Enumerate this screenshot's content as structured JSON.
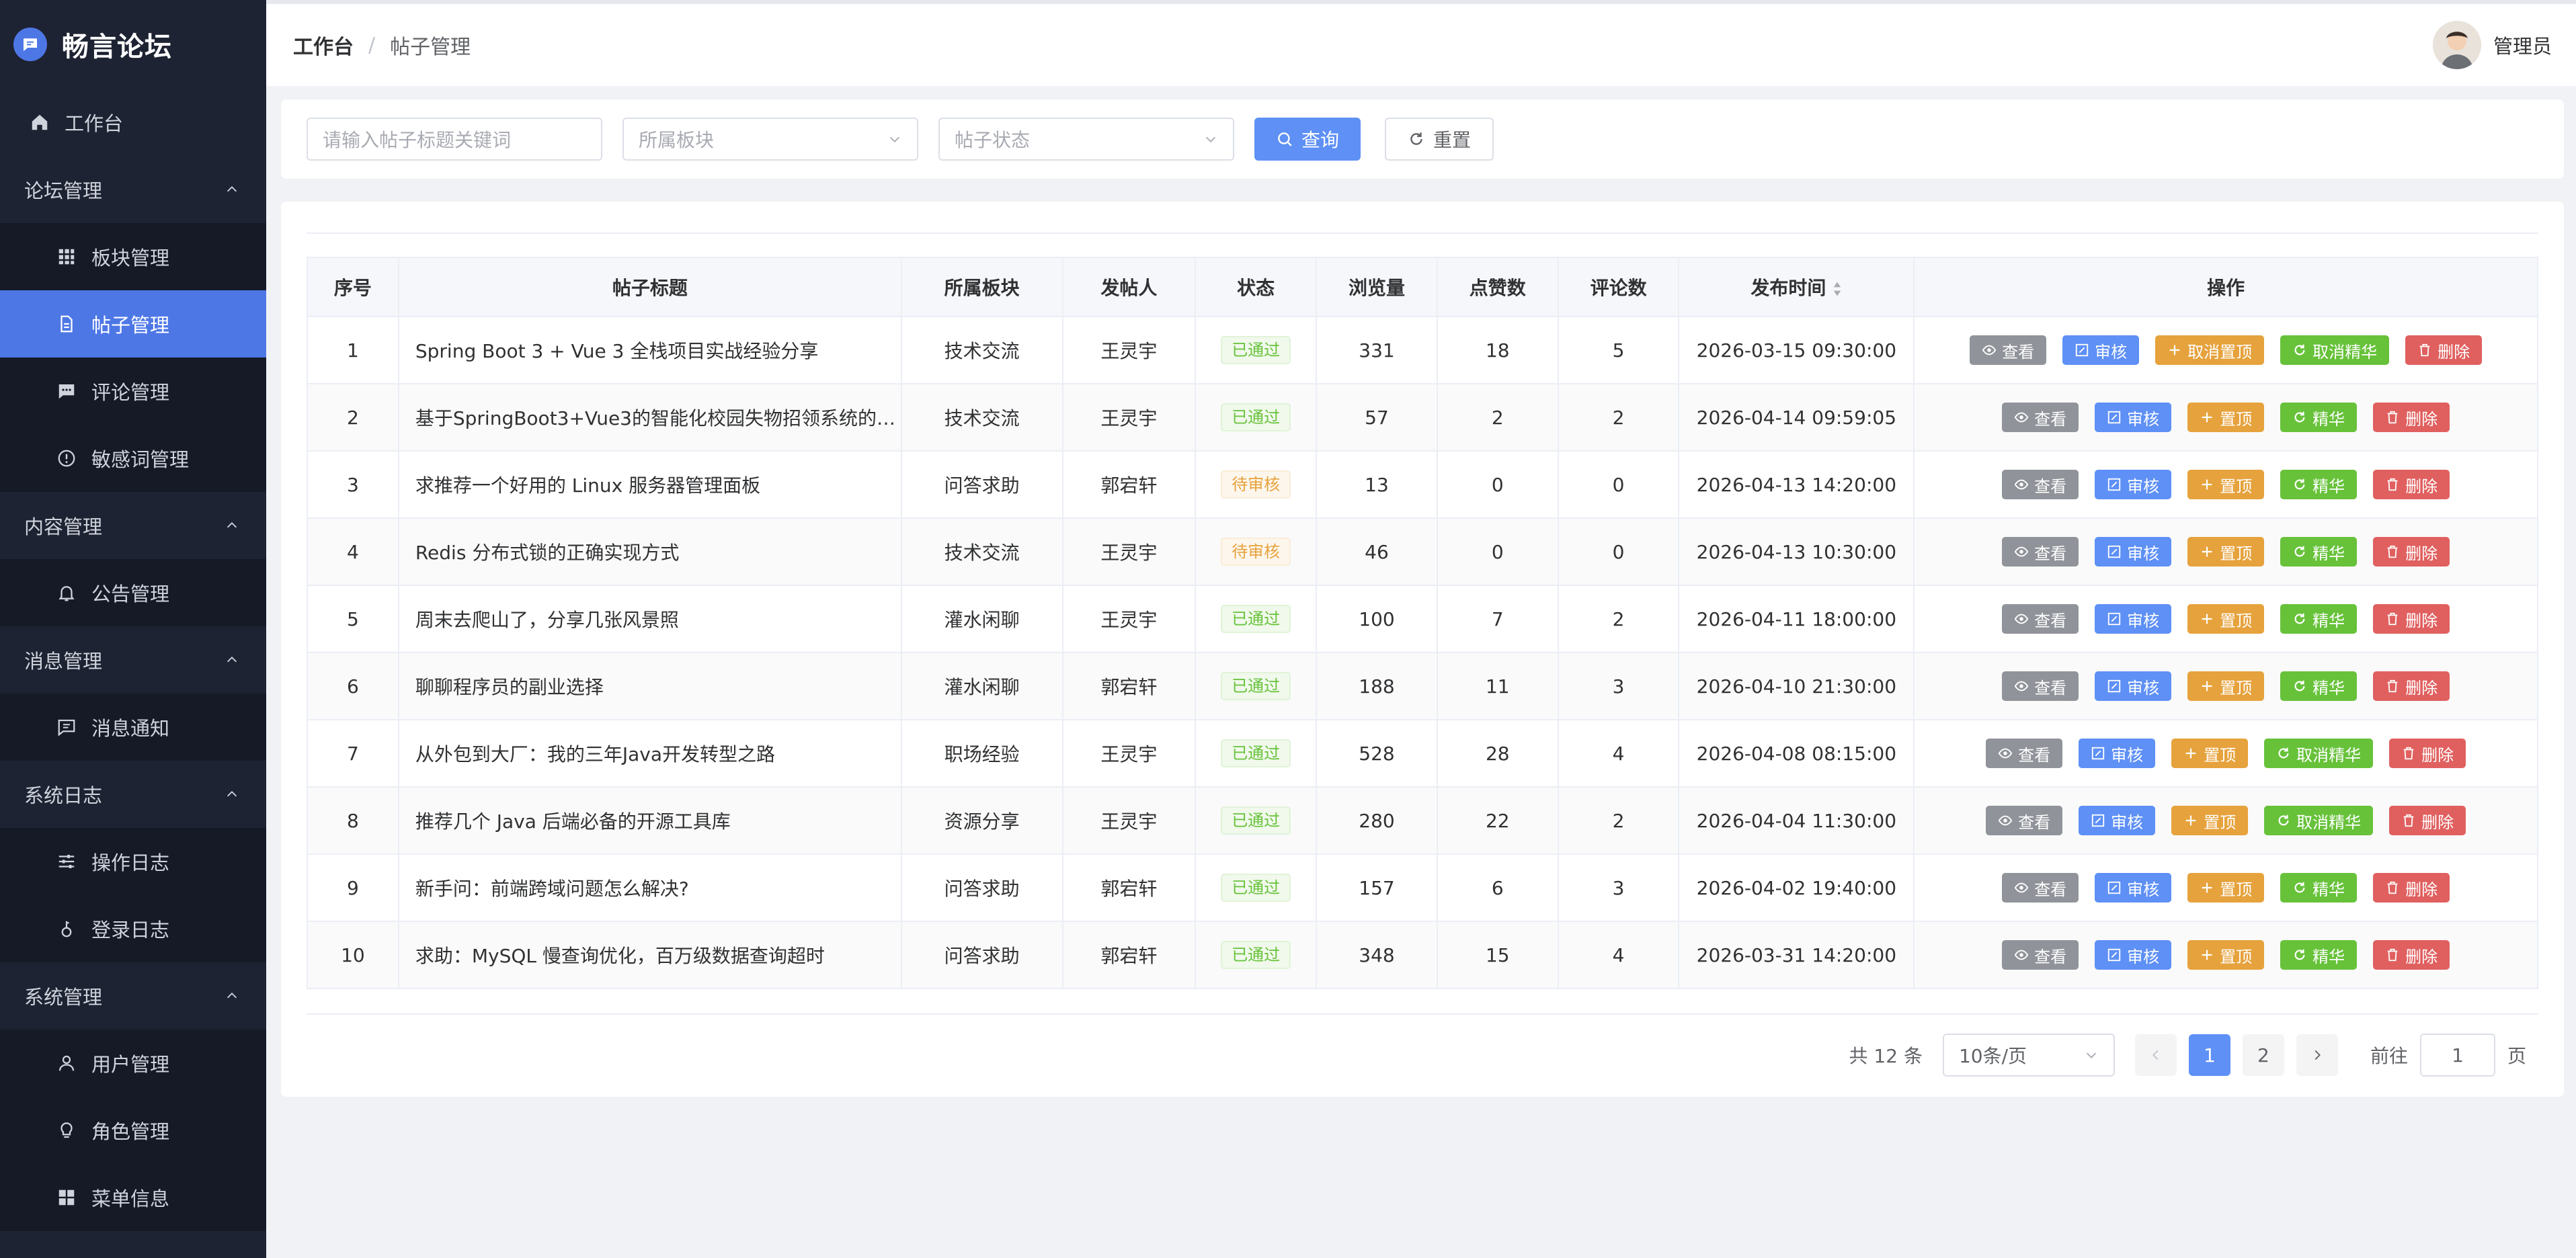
{
  "app": {
    "title": "畅言论坛"
  },
  "sidebar": {
    "home": "工作台",
    "groups": [
      {
        "label": "论坛管理",
        "items": [
          "板块管理",
          "帖子管理",
          "评论管理",
          "敏感词管理"
        ]
      },
      {
        "label": "内容管理",
        "items": [
          "公告管理"
        ]
      },
      {
        "label": "消息管理",
        "items": [
          "消息通知"
        ]
      },
      {
        "label": "系统日志",
        "items": [
          "操作日志",
          "登录日志"
        ]
      },
      {
        "label": "系统管理",
        "items": [
          "用户管理",
          "角色管理",
          "菜单信息"
        ]
      }
    ],
    "active_item": "帖子管理"
  },
  "header": {
    "breadcrumb": [
      "工作台",
      "帖子管理"
    ],
    "breadcrumb_sep": "/",
    "user_name": "管理员"
  },
  "filter": {
    "keyword_placeholder": "请输入帖子标题关键词",
    "section_placeholder": "所属板块",
    "status_placeholder": "帖子状态",
    "search_label": "查询",
    "reset_label": "重置"
  },
  "table": {
    "columns": [
      "序号",
      "帖子标题",
      "所属板块",
      "发帖人",
      "状态",
      "浏览量",
      "点赞数",
      "评论数",
      "发布时间",
      "操作"
    ],
    "rows": [
      {
        "no": "1",
        "title": "Spring Boot 3 + Vue 3 全栈项目实战经验分享",
        "section": "技术交流",
        "author": "王灵宇",
        "status": "已通过",
        "status_type": "ok",
        "views": "331",
        "likes": "18",
        "comments": "5",
        "time": "2026-03-15 09:30:00",
        "top_label": "取消置顶",
        "ess_label": "取消精华"
      },
      {
        "no": "2",
        "title": "基于SpringBoot3+Vue3的智能化校园失物招领系统的…",
        "section": "技术交流",
        "author": "王灵宇",
        "status": "已通过",
        "status_type": "ok",
        "views": "57",
        "likes": "2",
        "comments": "2",
        "time": "2026-04-14 09:59:05",
        "top_label": "置顶",
        "ess_label": "精华"
      },
      {
        "no": "3",
        "title": "求推荐一个好用的 Linux 服务器管理面板",
        "section": "问答求助",
        "author": "郭宕轩",
        "status": "待审核",
        "status_type": "wait",
        "views": "13",
        "likes": "0",
        "comments": "0",
        "time": "2026-04-13 14:20:00",
        "top_label": "置顶",
        "ess_label": "精华"
      },
      {
        "no": "4",
        "title": "Redis 分布式锁的正确实现方式",
        "section": "技术交流",
        "author": "王灵宇",
        "status": "待审核",
        "status_type": "wait",
        "views": "46",
        "likes": "0",
        "comments": "0",
        "time": "2026-04-13 10:30:00",
        "top_label": "置顶",
        "ess_label": "精华"
      },
      {
        "no": "5",
        "title": "周末去爬山了，分享几张风景照",
        "section": "灌水闲聊",
        "author": "王灵宇",
        "status": "已通过",
        "status_type": "ok",
        "views": "100",
        "likes": "7",
        "comments": "2",
        "time": "2026-04-11 18:00:00",
        "top_label": "置顶",
        "ess_label": "精华"
      },
      {
        "no": "6",
        "title": "聊聊程序员的副业选择",
        "section": "灌水闲聊",
        "author": "郭宕轩",
        "status": "已通过",
        "status_type": "ok",
        "views": "188",
        "likes": "11",
        "comments": "3",
        "time": "2026-04-10 21:30:00",
        "top_label": "置顶",
        "ess_label": "精华"
      },
      {
        "no": "7",
        "title": "从外包到大厂：我的三年Java开发转型之路",
        "section": "职场经验",
        "author": "王灵宇",
        "status": "已通过",
        "status_type": "ok",
        "views": "528",
        "likes": "28",
        "comments": "4",
        "time": "2026-04-08 08:15:00",
        "top_label": "置顶",
        "ess_label": "取消精华"
      },
      {
        "no": "8",
        "title": "推荐几个 Java 后端必备的开源工具库",
        "section": "资源分享",
        "author": "王灵宇",
        "status": "已通过",
        "status_type": "ok",
        "views": "280",
        "likes": "22",
        "comments": "2",
        "time": "2026-04-04 11:30:00",
        "top_label": "置顶",
        "ess_label": "取消精华"
      },
      {
        "no": "9",
        "title": "新手问：前端跨域问题怎么解决?",
        "section": "问答求助",
        "author": "郭宕轩",
        "status": "已通过",
        "status_type": "ok",
        "views": "157",
        "likes": "6",
        "comments": "3",
        "time": "2026-04-02 19:40:00",
        "top_label": "置顶",
        "ess_label": "精华"
      },
      {
        "no": "10",
        "title": "求助：MySQL 慢查询优化，百万级数据查询超时",
        "section": "问答求助",
        "author": "郭宕轩",
        "status": "已通过",
        "status_type": "ok",
        "views": "348",
        "likes": "15",
        "comments": "4",
        "time": "2026-03-31 14:20:00",
        "top_label": "置顶",
        "ess_label": "精华"
      }
    ],
    "op_labels": {
      "view": "查看",
      "audit": "审核",
      "delete": "删除"
    }
  },
  "pagination": {
    "total_text": "共 12 条",
    "page_size": "10条/页",
    "pages": [
      "1",
      "2"
    ],
    "current_page": "1",
    "goto_label": "前往",
    "goto_value": "1",
    "page_suffix": "页"
  },
  "colors": {
    "sidebar_bg": "#1e2333",
    "submenu_bg": "#161a27",
    "accent": "#5e90f5",
    "active_menu": "#4e77e6",
    "view_btn": "#909399",
    "top_btn": "#e6a23c",
    "essence_btn": "#67c23a",
    "delete_btn": "#e0605f",
    "tag_ok": "#67c23a",
    "tag_wait": "#e6a23c"
  }
}
